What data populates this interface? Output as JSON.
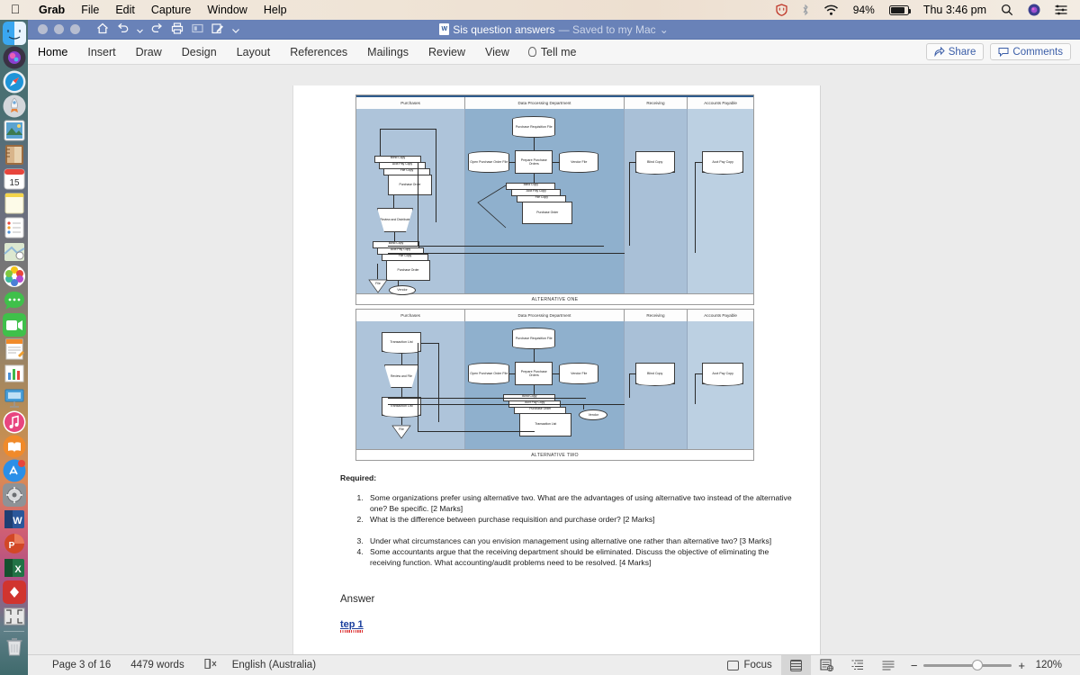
{
  "menubar": {
    "apple": "apple-logo",
    "items": [
      "Grab",
      "File",
      "Edit",
      "Capture",
      "Window",
      "Help"
    ],
    "status": {
      "shield": "shield-icon",
      "bluetooth": "bluetooth-icon",
      "wifi": "wifi-icon",
      "battery_pct": "94%",
      "clock": "Thu 3:46 pm",
      "spotlight": "search-icon",
      "siri": "siri-icon",
      "control_center": "list-icon"
    }
  },
  "dock": {
    "items": [
      {
        "name": "finder",
        "running": true
      },
      {
        "name": "siri",
        "running": false
      },
      {
        "name": "safari",
        "running": true
      },
      {
        "name": "launchpad",
        "running": false
      },
      {
        "name": "photos-preview",
        "running": false
      },
      {
        "name": "contacts",
        "running": false
      },
      {
        "name": "calendar",
        "running": false,
        "label": "15"
      },
      {
        "name": "notes",
        "running": false
      },
      {
        "name": "reminders",
        "running": false
      },
      {
        "name": "maps",
        "running": false
      },
      {
        "name": "photos",
        "running": false
      },
      {
        "name": "messages",
        "running": false
      },
      {
        "name": "facetime",
        "running": false
      },
      {
        "name": "pages",
        "running": false
      },
      {
        "name": "numbers",
        "running": false
      },
      {
        "name": "keynote",
        "running": false
      },
      {
        "name": "itunes",
        "running": false
      },
      {
        "name": "ibooks",
        "running": false
      },
      {
        "name": "app-store",
        "running": false
      },
      {
        "name": "system-preferences",
        "running": false
      },
      {
        "name": "microsoft-word",
        "running": true
      },
      {
        "name": "microsoft-powerpoint",
        "running": true
      },
      {
        "name": "microsoft-excel",
        "running": true
      },
      {
        "name": "adobe-acrobat",
        "running": true
      },
      {
        "name": "grab",
        "running": true
      },
      {
        "name": "trash",
        "running": false
      }
    ]
  },
  "window": {
    "title": "Sis question answers",
    "save_state": "— Saved to my Mac",
    "quick_access": [
      "home-icon",
      "undo-icon",
      "undo-dropdown-icon",
      "redo-icon",
      "print-icon",
      "rect-icon",
      "edit-icon",
      "overflow-icon"
    ]
  },
  "ribbon": {
    "tabs": [
      "Home",
      "Insert",
      "Draw",
      "Design",
      "Layout",
      "References",
      "Mailings",
      "Review",
      "View"
    ],
    "tellme": "Tell me",
    "share": "Share",
    "comments": "Comments"
  },
  "document": {
    "figure": {
      "alt_one": {
        "caption": "ALTERNATIVE ONE",
        "lanes": [
          "Purchases",
          "Data Processing Department",
          "Receiving",
          "Accounts Payable"
        ],
        "nodes": [
          {
            "lane": "Purchases",
            "label": "Blind Copy",
            "type": "document"
          },
          {
            "lane": "Purchases",
            "label": "Acct Pay Copy",
            "type": "document"
          },
          {
            "lane": "Purchases",
            "label": "File Copy",
            "type": "document"
          },
          {
            "lane": "Purchases",
            "label": "Purchase Order",
            "type": "document"
          },
          {
            "lane": "Purchases",
            "label": "Review and Distribute",
            "type": "manual-operation"
          },
          {
            "lane": "Purchases",
            "label": "Blind Copy",
            "type": "document"
          },
          {
            "lane": "Purchases",
            "label": "Acct Pay Copy",
            "type": "document"
          },
          {
            "lane": "Purchases",
            "label": "File Copy",
            "type": "document"
          },
          {
            "lane": "Purchases",
            "label": "Purchase Order",
            "type": "document"
          },
          {
            "lane": "Purchases",
            "label": "File",
            "type": "offline-store"
          },
          {
            "lane": "Purchases",
            "label": "Vendor",
            "type": "terminator"
          },
          {
            "lane": "Data Processing Department",
            "label": "Purchase Requisition File",
            "type": "database"
          },
          {
            "lane": "Data Processing Department",
            "label": "Prepare Purchase Orders",
            "type": "process"
          },
          {
            "lane": "Data Processing Department",
            "label": "Open Purchase Order File",
            "type": "database"
          },
          {
            "lane": "Data Processing Department",
            "label": "Vendor File",
            "type": "database"
          },
          {
            "lane": "Data Processing Department",
            "label": "Blind Copy",
            "type": "document"
          },
          {
            "lane": "Data Processing Department",
            "label": "Acct Pay Copy",
            "type": "document"
          },
          {
            "lane": "Data Processing Department",
            "label": "File Copy",
            "type": "document"
          },
          {
            "lane": "Data Processing Department",
            "label": "Purchase Order",
            "type": "document"
          },
          {
            "lane": "Receiving",
            "label": "Blind Copy",
            "type": "document"
          },
          {
            "lane": "Accounts Payable",
            "label": "Acct Pay Copy",
            "type": "document"
          }
        ]
      },
      "alt_two": {
        "caption": "ALTERNATIVE TWO",
        "lanes": [
          "Purchases",
          "Data Processing Department",
          "Receiving",
          "Accounts Payable"
        ],
        "nodes": [
          {
            "lane": "Purchases",
            "label": "Transaction List",
            "type": "document"
          },
          {
            "lane": "Purchases",
            "label": "Review and File",
            "type": "manual-operation"
          },
          {
            "lane": "Purchases",
            "label": "Transaction List",
            "type": "document"
          },
          {
            "lane": "Purchases",
            "label": "File",
            "type": "offline-store"
          },
          {
            "lane": "Data Processing Department",
            "label": "Purchase Requisition File",
            "type": "database"
          },
          {
            "lane": "Data Processing Department",
            "label": "Prepare Purchase Orders",
            "type": "process"
          },
          {
            "lane": "Data Processing Department",
            "label": "Open Purchase Order File",
            "type": "database"
          },
          {
            "lane": "Data Processing Department",
            "label": "Vendor File",
            "type": "database"
          },
          {
            "lane": "Data Processing Department",
            "label": "Blind Copy",
            "type": "document"
          },
          {
            "lane": "Data Processing Department",
            "label": "Acct Pay Copy",
            "type": "document"
          },
          {
            "lane": "Data Processing Department",
            "label": "Purchase Order",
            "type": "document"
          },
          {
            "lane": "Data Processing Department",
            "label": "Transaction List",
            "type": "document"
          },
          {
            "lane": "Data Processing Department",
            "label": "Vendor",
            "type": "terminator"
          },
          {
            "lane": "Receiving",
            "label": "Blind Copy",
            "type": "document"
          },
          {
            "lane": "Accounts Payable",
            "label": "Acct Pay Copy",
            "type": "document"
          }
        ]
      }
    },
    "required_heading": "Required:",
    "questions": [
      "Some organizations prefer using alternative two. What are the advantages of using alternative two instead of the alternative one? Be specific. [2 Marks]",
      "What is the difference between purchase requisition and purchase order? [2 Marks]",
      "Under what circumstances can you envision management using alternative one rather than alternative two? [3 Marks]",
      "Some accountants argue that the receiving department should be eliminated. Discuss the objective of eliminating the receiving function. What accounting/audit problems need to be resolved. [4 Marks]"
    ],
    "answer_heading": "Answer",
    "step_heading": "tep 1"
  },
  "statusbar": {
    "page": "Page 3 of 16",
    "words": "4479 words",
    "proofing": "proofing-icon",
    "language": "English (Australia)",
    "focus": "Focus",
    "views": [
      "print-layout-icon",
      "web-layout-icon",
      "outline-icon",
      "draft-icon"
    ],
    "zoom_out": "−",
    "zoom_in": "+",
    "zoom_value": "120%"
  },
  "colors": {
    "titlebar": "#6982b8",
    "accent": "#3b5ea8",
    "lane_fill": "#8fb0cd",
    "canvas": "#ebebeb"
  }
}
